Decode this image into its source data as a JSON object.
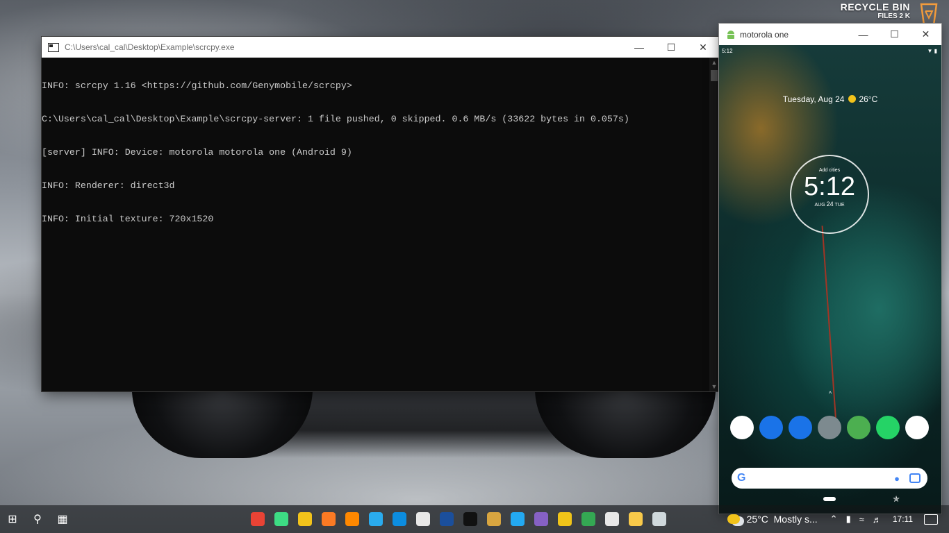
{
  "desktop": {
    "recycle_title": "RECYCLE BIN",
    "recycle_subtitle": "FILES 2 K"
  },
  "console": {
    "title": "C:\\Users\\cal_cal\\Desktop\\Example\\scrcpy.exe",
    "lines": [
      "INFO: scrcpy 1.16 <https://github.com/Genymobile/scrcpy>",
      "C:\\Users\\cal_cal\\Desktop\\Example\\scrcpy-server: 1 file pushed, 0 skipped. 0.6 MB/s (33622 bytes in 0.057s)",
      "[server] INFO: Device: motorola motorola one (Android 9)",
      "INFO: Renderer: direct3d",
      "INFO: Initial texture: 720x1520"
    ]
  },
  "phone": {
    "title": "motorola one",
    "status_time": "5:12",
    "date_text": "Tuesday, Aug 24",
    "temperature": "26°C",
    "clock_cities": "Add cities",
    "clock_time": "5:12",
    "clock_month": "AUG",
    "clock_day": "24",
    "clock_weekday": "TUE",
    "dock_apps": [
      {
        "icon": "pubg-icon",
        "color": "#ffffff"
      },
      {
        "icon": "phone-icon",
        "color": "#1a73e8"
      },
      {
        "icon": "messages-icon",
        "color": "#1a73e8"
      },
      {
        "icon": "camera-icon",
        "color": "#7d8a8f"
      },
      {
        "icon": "stack-game-icon",
        "color": "#4caf50"
      },
      {
        "icon": "whatsapp-icon",
        "color": "#25d366"
      },
      {
        "icon": "call-of-duty-icon",
        "color": "#ffffff"
      }
    ]
  },
  "taskbar": {
    "weather_temp": "25°C",
    "weather_text": "Mostly s...",
    "time": "17:11",
    "apps": [
      {
        "icon": "chrome-icon",
        "color": "#e94335"
      },
      {
        "icon": "android-studio-icon",
        "color": "#3ddc84"
      },
      {
        "icon": "player-icon",
        "color": "#f2c31b"
      },
      {
        "icon": "xampp-icon",
        "color": "#fb7a24"
      },
      {
        "icon": "vlc-icon",
        "color": "#ff8800"
      },
      {
        "icon": "telegram-icon",
        "color": "#2aabee"
      },
      {
        "icon": "remote-icon",
        "color": "#0c8de0"
      },
      {
        "icon": "store-icon",
        "color": "#e8e8e8"
      },
      {
        "icon": "app-icon",
        "color": "#1b4f9c"
      },
      {
        "icon": "need-for-speed-icon",
        "color": "#111111"
      },
      {
        "icon": "cube-icon",
        "color": "#d8a540"
      },
      {
        "icon": "vscode-icon",
        "color": "#23a9f2"
      },
      {
        "icon": "visual-studio-icon",
        "color": "#8661c5"
      },
      {
        "icon": "mail-icon",
        "color": "#f0c419"
      },
      {
        "icon": "chrome-2-icon",
        "color": "#34a853"
      },
      {
        "icon": "news-icon",
        "color": "#e8e8e8"
      },
      {
        "icon": "file-explorer-icon",
        "color": "#f8c94a"
      },
      {
        "icon": "scrcpy-icon",
        "color": "#cfd8dc"
      }
    ]
  }
}
